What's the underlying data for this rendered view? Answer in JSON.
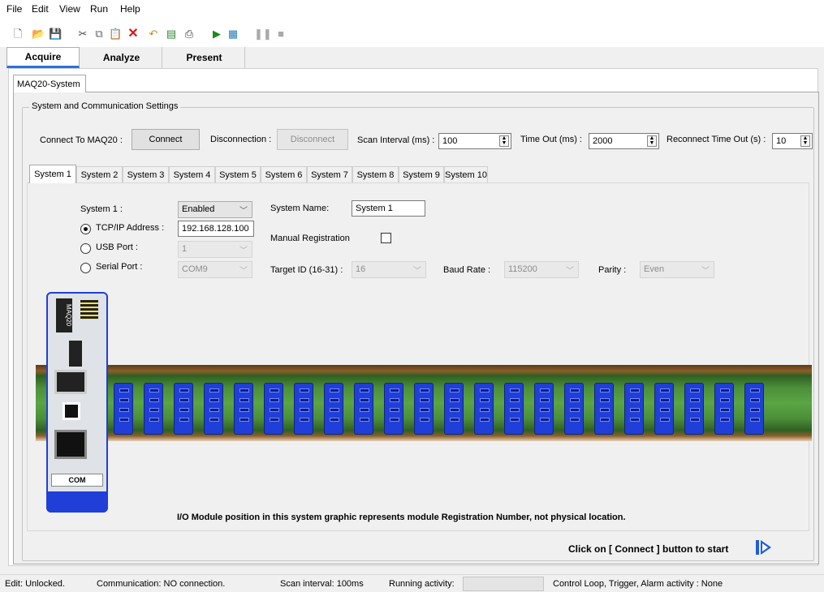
{
  "menu": [
    "File",
    "Edit",
    "View",
    "Run",
    "Help"
  ],
  "toolbar_icons": [
    "new-icon",
    "open-icon",
    "save-icon",
    "cut-icon",
    "copy-icon",
    "paste-icon",
    "delete-icon",
    "undo-icon",
    "duplicate-icon",
    "print-icon",
    "run-icon",
    "config-icon",
    "pause-icon",
    "stop-icon"
  ],
  "main_tabs": {
    "acquire": "Acquire",
    "analyze": "Analyze",
    "present": "Present"
  },
  "doc_tab": "MAQ20-System",
  "group_title": "System and Communication Settings",
  "comm": {
    "connect_label": "Connect To MAQ20 :",
    "connect_button": "Connect",
    "disconnect_label": "Disconnection :",
    "disconnect_button": "Disconnect",
    "scan_label": "Scan Interval (ms) :",
    "scan_value": "100",
    "timeout_label": "Time Out (ms) :",
    "timeout_value": "2000",
    "reconnect_label": "Reconnect Time Out (s) :",
    "reconnect_value": "10"
  },
  "system_tabs": [
    "System 1",
    "System 2",
    "System 3",
    "System 4",
    "System 5",
    "System 6",
    "System 7",
    "System 8",
    "System 9",
    "System 10"
  ],
  "system": {
    "system_label": "System 1 :",
    "system_state": "Enabled",
    "name_label": "System Name:",
    "name_value": "System 1",
    "tcp_label": "TCP/IP Address :",
    "tcp_value": "192.168.128.100",
    "manual_reg_label": "Manual Registration",
    "usb_label": "USB Port :",
    "usb_value": "1",
    "serial_label": "Serial  Port :",
    "serial_value": "COM9",
    "target_label": "Target ID (16-31) :",
    "target_value": "16",
    "baud_label": "Baud Rate :",
    "baud_value": "115200",
    "parity_label": "Parity :",
    "parity_value": "Even"
  },
  "graphic": {
    "controller_label": "COM",
    "brand": "MAQ20",
    "note": "I/O Module position in this system graphic represents module Registration Number, not physical location."
  },
  "click_note": "Click on [ Connect ] button to start",
  "status": {
    "edit": "Edit: Unlocked.",
    "communication": "Communication: NO connection.",
    "scan": "Scan interval: 100ms",
    "running": "Running activity:",
    "control": "Control Loop, Trigger, Alarm activity : None"
  }
}
